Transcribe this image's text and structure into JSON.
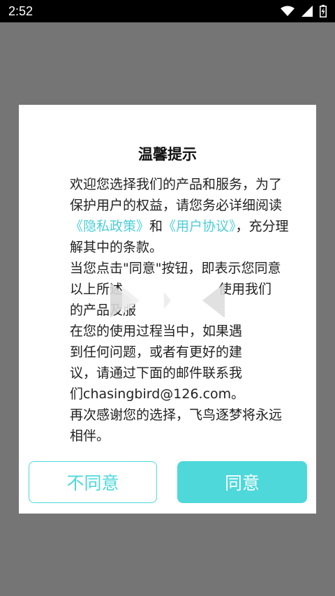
{
  "status_bar": {
    "time": "2:52",
    "icons": [
      "wifi-icon",
      "signal-icon",
      "battery-charging-icon"
    ]
  },
  "dialog": {
    "title": "温馨提示",
    "paragraph1": {
      "text_before": "欢迎您选择我们的产品和服务，为了保护用户的权益，请您务必详细阅读",
      "privacy_link": "《隐私政策》",
      "text_middle": "和",
      "agreement_link": "《用户协议》",
      "text_after": "，充分理解其中的条款。"
    },
    "paragraph2_line1": "当您点击\"同意\"按钮，即表示您同",
    "paragraph2_line2": "意以上所述",
    "paragraph2_line2_end": "使用我们",
    "paragraph2_line3": "的产品及服",
    "paragraph3": "在您的使用过程当中，如果遇到任何问题，或者有更好的建议，请通过下面的邮件联系我们chasingbird@126.com。",
    "paragraph4": "再次感谢您的选择，飞鸟逐梦将永远相伴。",
    "disagree_button": "不同意",
    "agree_button": "同意"
  },
  "colors": {
    "accent": "#4ed8da",
    "link": "#4ecfd6",
    "backdrop": "#757575"
  }
}
